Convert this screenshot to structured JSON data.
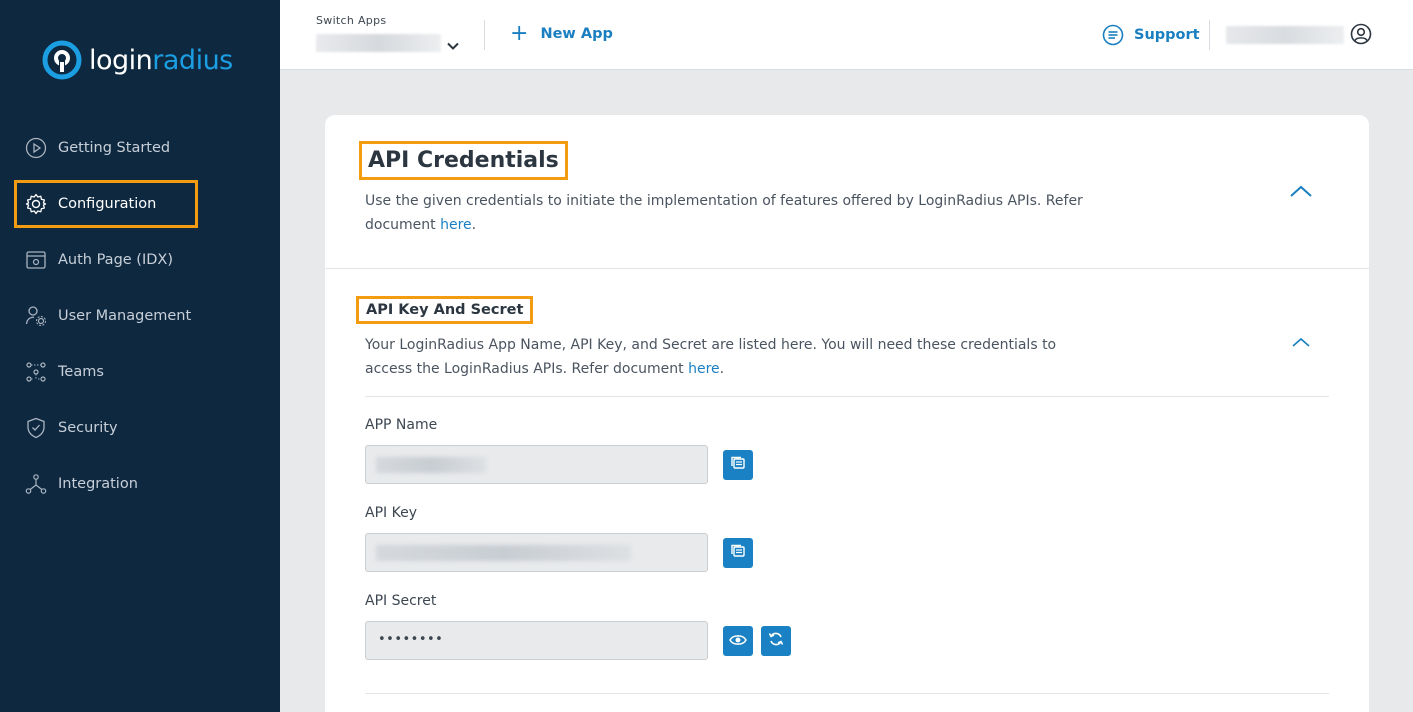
{
  "brand": {
    "logo_text_a": "login",
    "logo_text_b": "radius"
  },
  "sidebar": {
    "items": [
      {
        "label": "Getting Started",
        "icon": "play-circle-icon"
      },
      {
        "label": "Configuration",
        "icon": "gear-icon",
        "active": true
      },
      {
        "label": "Auth Page (IDX)",
        "icon": "browser-gear-icon"
      },
      {
        "label": "User Management",
        "icon": "user-gear-icon"
      },
      {
        "label": "Teams",
        "icon": "team-network-icon"
      },
      {
        "label": "Security",
        "icon": "shield-icon"
      },
      {
        "label": "Integration",
        "icon": "integration-nodes-icon"
      }
    ]
  },
  "topbar": {
    "switch_apps_label": "Switch Apps",
    "new_app_label": "New App",
    "support_label": "Support"
  },
  "main": {
    "title": "API Credentials",
    "description": "Use the given credentials to initiate the implementation of features offered by LoginRadius APIs. Refer document ",
    "description_link": "here",
    "description_end": ".",
    "subsection": {
      "title": "API Key And Secret",
      "description": "Your LoginRadius App Name, API Key, and Secret are listed here. You will need these credentials to access the LoginRadius APIs. Refer document ",
      "description_link": "here",
      "description_end": "."
    },
    "fields": {
      "app_name_label": "APP Name",
      "api_key_label": "API Key",
      "api_secret_label": "API Secret",
      "api_secret_value": "••••••••"
    }
  },
  "colors": {
    "sidebar_bg": "#0e2840",
    "accent": "#1a82c4",
    "highlight_border": "#f39c12"
  }
}
